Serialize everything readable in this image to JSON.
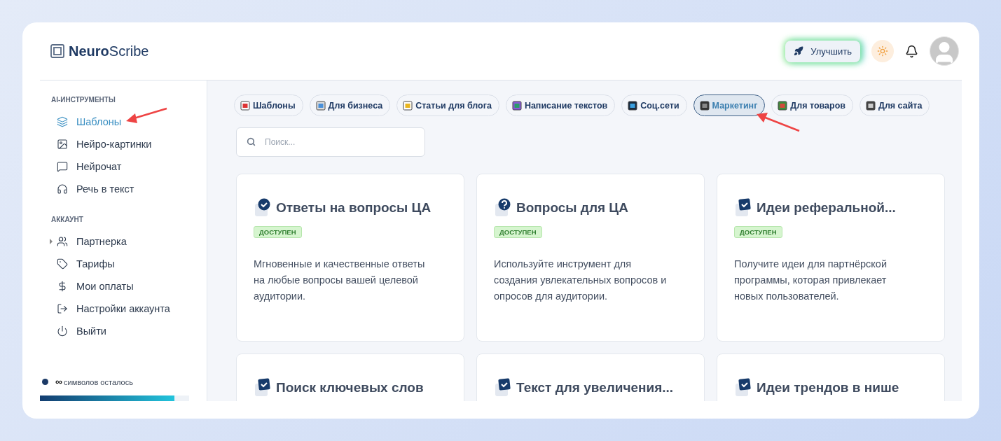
{
  "logo": {
    "text": "**Neuro**Scribe"
  },
  "header": {
    "upgrade_button": "Улучшить"
  },
  "sidebar": {
    "sections": [
      {
        "title": "AI-ИНСТРУМЕНТЫ",
        "items": [
          {
            "label": "Шаблоны",
            "selected": true
          },
          {
            "label": "Нейро-картинки",
            "selected": false
          },
          {
            "label": "Нейрочат",
            "selected": false
          },
          {
            "label": "Речь в текст",
            "selected": false
          }
        ]
      },
      {
        "title": "АККАУНТ",
        "items": [
          {
            "label": "Партнерка",
            "selected": false,
            "expanded": false
          },
          {
            "label": "Тарифы",
            "selected": false
          },
          {
            "label": "Мои оплаты",
            "selected": false
          },
          {
            "label": "Настройки аккаунта",
            "selected": false
          },
          {
            "label": "Выйти",
            "selected": false
          }
        ]
      }
    ],
    "usage": {
      "symbol": "∞",
      "text": "символов осталось",
      "level": 0.9
    }
  },
  "categories": [
    {
      "label": "Шаблоны",
      "selected": false
    },
    {
      "label": "Для бизнеса",
      "selected": false
    },
    {
      "label": "Статьи для блога",
      "selected": false
    },
    {
      "label": "Написание текстов",
      "selected": false
    },
    {
      "label": "Соц.сети",
      "selected": false
    },
    {
      "label": "Маркетинг",
      "selected": true
    },
    {
      "label": "Для товаров",
      "selected": false
    },
    {
      "label": "Для сайта",
      "selected": false
    }
  ],
  "search": {
    "placeholder": "Поиск..."
  },
  "cards": [
    {
      "kind": "circle",
      "title": "Ответы на вопросы ЦА",
      "badge": "ДОСТУПЕН",
      "description": "Мгновенные и качественные ответы на любые вопросы вашей целевой аудитории."
    },
    {
      "kind": "question",
      "title": "Вопросы для ЦА",
      "badge": "ДОСТУПЕН",
      "description": "Используйте инструмент для создания увлекательных вопросов и опросов для аудитории."
    },
    {
      "kind": "square",
      "title": "Идеи реферальной...",
      "badge": "ДОСТУПЕН",
      "description": "Получите идеи для партнёрской программы, которая привлекает новых пользователей."
    },
    {
      "kind": "square",
      "title": "Поиск ключевых слов"
    },
    {
      "kind": "square",
      "title": "Текст для увеличения..."
    },
    {
      "kind": "square",
      "title": "Идеи трендов в нише"
    }
  ]
}
